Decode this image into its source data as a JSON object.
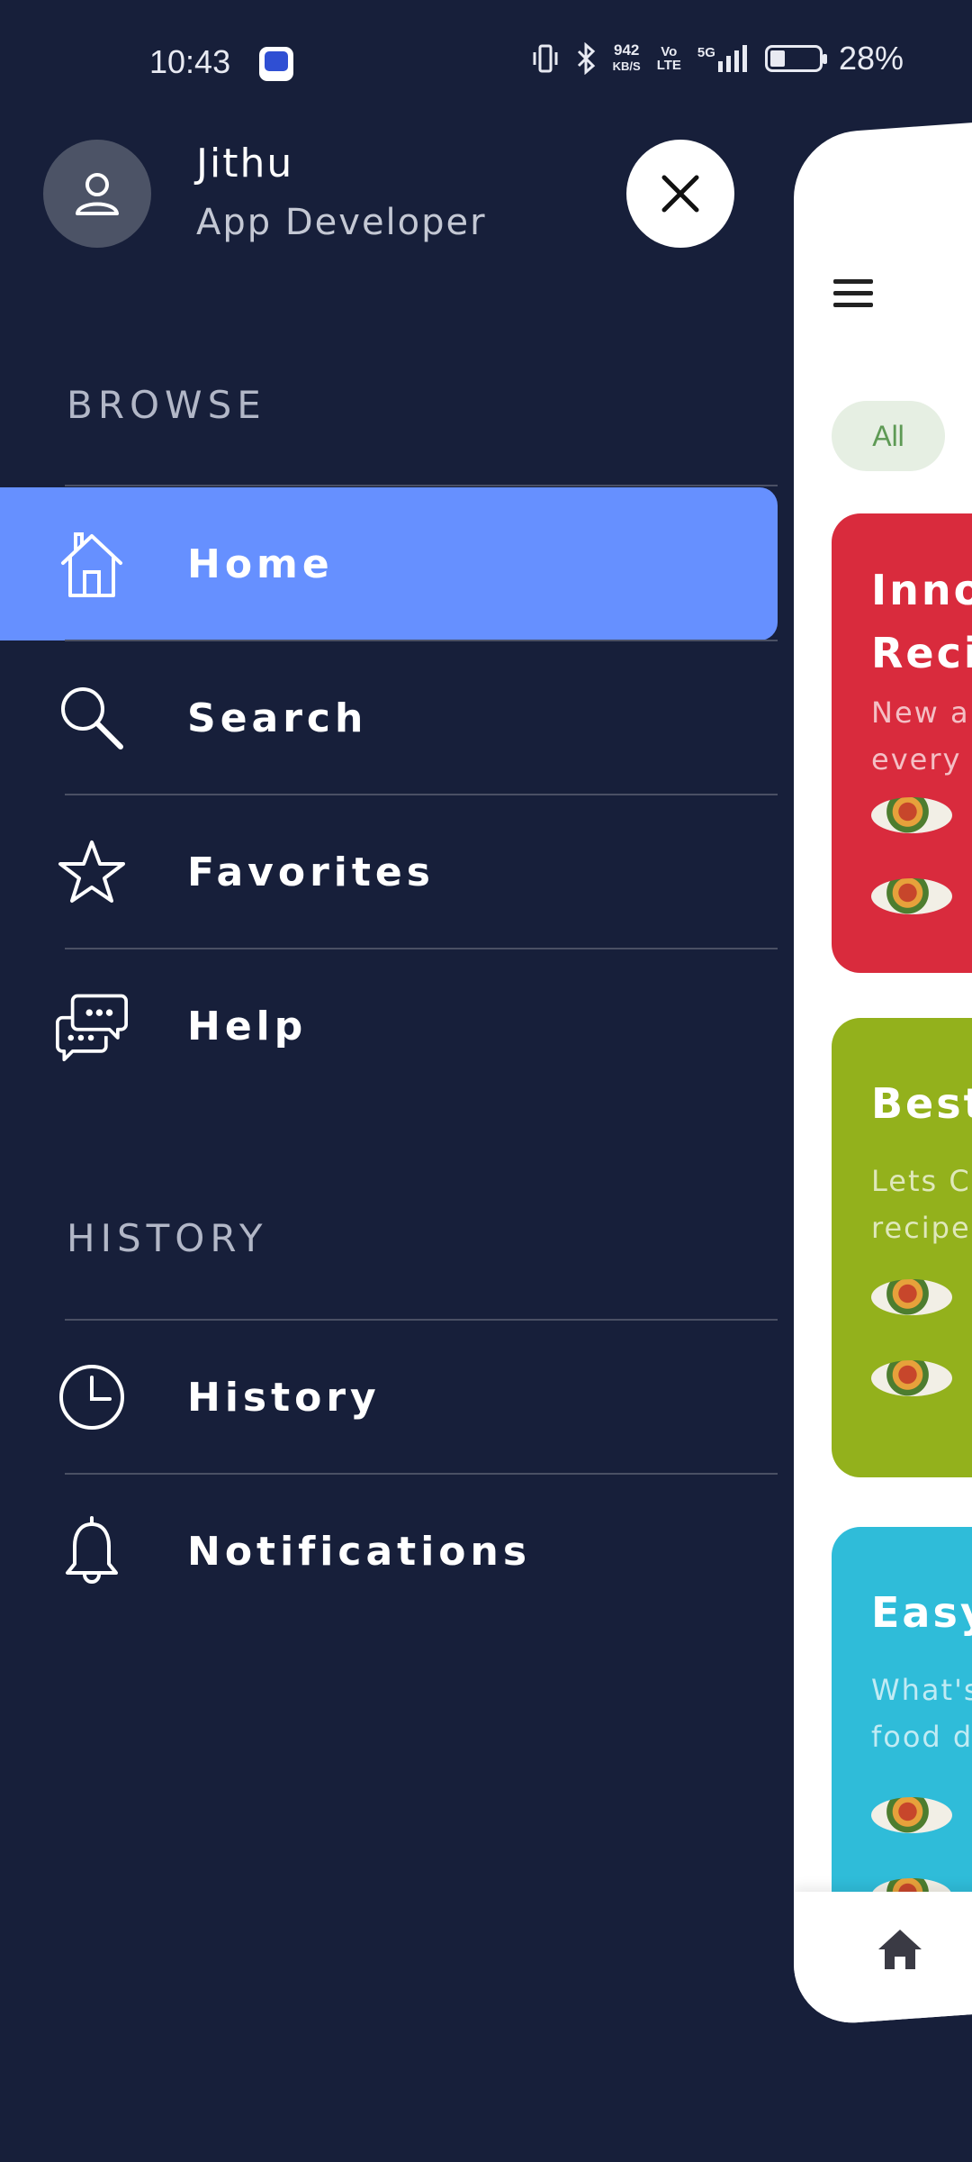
{
  "status_bar": {
    "time": "10:43",
    "net_speed_value": "942",
    "net_speed_unit": "KB/S",
    "volte_top": "Vo",
    "volte_bottom": "LTE",
    "network": "5G",
    "battery_percent": "28%"
  },
  "profile": {
    "name": "Jithu",
    "role": "App Developer"
  },
  "sections": {
    "browse": "BROWSE",
    "history": "HISTORY"
  },
  "menu": {
    "home": "Home",
    "search": "Search",
    "favorites": "Favorites",
    "help": "Help",
    "history": "History",
    "notifications": "Notifications"
  },
  "app": {
    "filter_chip": "All",
    "cards": [
      {
        "title": "Innov\nRecip",
        "subtitle": "New an\nevery M",
        "color": "#d92b3d"
      },
      {
        "title": "Best",
        "subtitle": "Lets Co\nrecipes",
        "color": "#93b11c"
      },
      {
        "title": "Easy",
        "subtitle": "What's\nfood di",
        "color": "#2fbcd9"
      }
    ]
  },
  "colors": {
    "drawer_background": "#171f3a",
    "active_item": "#6690ff"
  }
}
